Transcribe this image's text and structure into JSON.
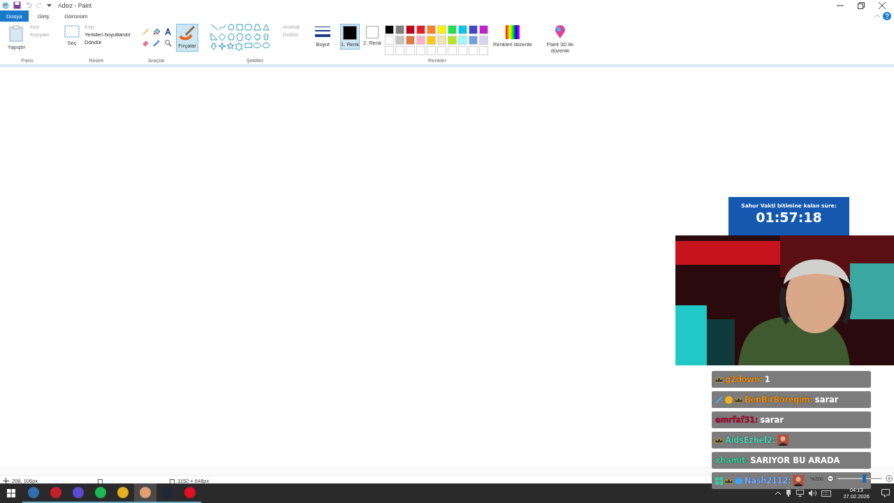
{
  "window": {
    "title": "Adsız - Paint"
  },
  "tabs": [
    {
      "label": "Dosya",
      "selected": true
    },
    {
      "label": "Giriş",
      "selected": false
    },
    {
      "label": "Görünüm",
      "selected": false
    }
  ],
  "ribbon": {
    "pano": {
      "label": "Pano",
      "paste": "Yapıştır",
      "cut": {
        "label": "Kes",
        "disabled": true
      },
      "copy": {
        "label": "Kopyala",
        "disabled": true
      }
    },
    "resim": {
      "label": "Resim",
      "select": "Seç",
      "crop": {
        "label": "Kırp",
        "disabled": true
      },
      "resize": {
        "label": "Yeniden boyutlandır",
        "disabled": false
      },
      "rotate": {
        "label": "Döndür",
        "disabled": false
      }
    },
    "tools": {
      "label": "Araçlar"
    },
    "brushes": {
      "label": "Fırçalar",
      "selected": true
    },
    "shapes": {
      "label": "Şekiller",
      "outline": {
        "label": "Anahat",
        "disabled": true
      },
      "fill": {
        "label": "Doldur",
        "disabled": true
      }
    },
    "size": {
      "label": "Boyut"
    },
    "colors": {
      "label": "Renkler",
      "color1": {
        "label": "1. Renk",
        "color": "#000000",
        "selected": true
      },
      "color2": {
        "label": "2. Renk",
        "color": "#ffffff",
        "selected": false
      },
      "palette": [
        {
          "color": "#000000"
        },
        {
          "color": "#7f7f7f"
        },
        {
          "color": "#c3001c"
        },
        {
          "color": "#ec1c24"
        },
        {
          "color": "#ff7f27"
        },
        {
          "color": "#fff200"
        },
        {
          "color": "#22e04c"
        },
        {
          "color": "#00c8f0"
        },
        {
          "color": "#3f48cc"
        },
        {
          "color": "#c320d0"
        },
        {
          "color": "#ffffff"
        },
        {
          "color": "#c3c3c3"
        },
        {
          "color": "#e07a3c"
        },
        {
          "color": "#ffaec9"
        },
        {
          "color": "#ffc90e"
        },
        {
          "color": "#efe4b0"
        },
        {
          "color": "#b5e61d"
        },
        {
          "color": "#99ffff"
        },
        {
          "color": "#70a0e0"
        },
        {
          "color": "#dcd0f0"
        },
        {
          "color": "#ffffff"
        },
        {
          "color": "#ffffff"
        },
        {
          "color": "#ffffff"
        },
        {
          "color": "#ffffff"
        },
        {
          "color": "#ffffff"
        },
        {
          "color": "#ffffff"
        },
        {
          "color": "#ffffff"
        },
        {
          "color": "#ffffff"
        },
        {
          "color": "#ffffff"
        },
        {
          "color": "#ffffff"
        }
      ],
      "edit": "Renkleri düzenle"
    },
    "paint3d": "Paint 3D ile düzenle"
  },
  "timer": {
    "caption": "Sahur Vakti bitimine kalan süre:",
    "time": "01:57:18"
  },
  "chat": [
    {
      "user": "g2down:",
      "color": "#e8901c",
      "text": "1",
      "kind": "text",
      "badges": [
        {
          "kind": "crown"
        }
      ]
    },
    {
      "user": "BenBirBoregim:",
      "color": "#e8901c",
      "text": "sarar",
      "kind": "text",
      "badges": [
        {
          "kind": "sword"
        },
        {
          "kind": "coin"
        },
        {
          "kind": "crown"
        }
      ]
    },
    {
      "user": "emrfaf31:",
      "color": "#b0103a",
      "text": "sarar",
      "kind": "text"
    },
    {
      "user": "AidsEzhel2:",
      "color": "#4fd1b0",
      "kind": "emote",
      "badges": [
        {
          "kind": "crown"
        }
      ]
    },
    {
      "user": "xhamit:",
      "color": "#3ec79a",
      "text": "SARIYOR BU ARADA",
      "kind": "text"
    },
    {
      "user": "Nash2112:",
      "color": "#7ab0ff",
      "kind": "emote",
      "badges": [
        {
          "kind": "grid"
        },
        {
          "kind": "crown"
        },
        {
          "kind": "cube"
        }
      ]
    }
  ],
  "status_bar": {
    "cursor_position": "208, 106px",
    "canvas_size": "1152 × 648px",
    "zoom": {
      "reading": "%200",
      "level": 0.6
    }
  },
  "taskbar": {
    "apps": [
      {
        "color": "#2f6fb0",
        "selected": false
      },
      {
        "color": "#c8202a",
        "selected": false
      },
      {
        "color": "#5b4bd0",
        "selected": false
      },
      {
        "color": "#1db954",
        "selected": false
      },
      {
        "color": "#e8b020",
        "selected": false
      },
      {
        "color": "#e0a070",
        "selected": true
      },
      {
        "color": "#1b2838",
        "selected": false
      },
      {
        "color": "#e01020",
        "selected": false
      }
    ],
    "time": "04:13",
    "date": "27.02.2026"
  }
}
